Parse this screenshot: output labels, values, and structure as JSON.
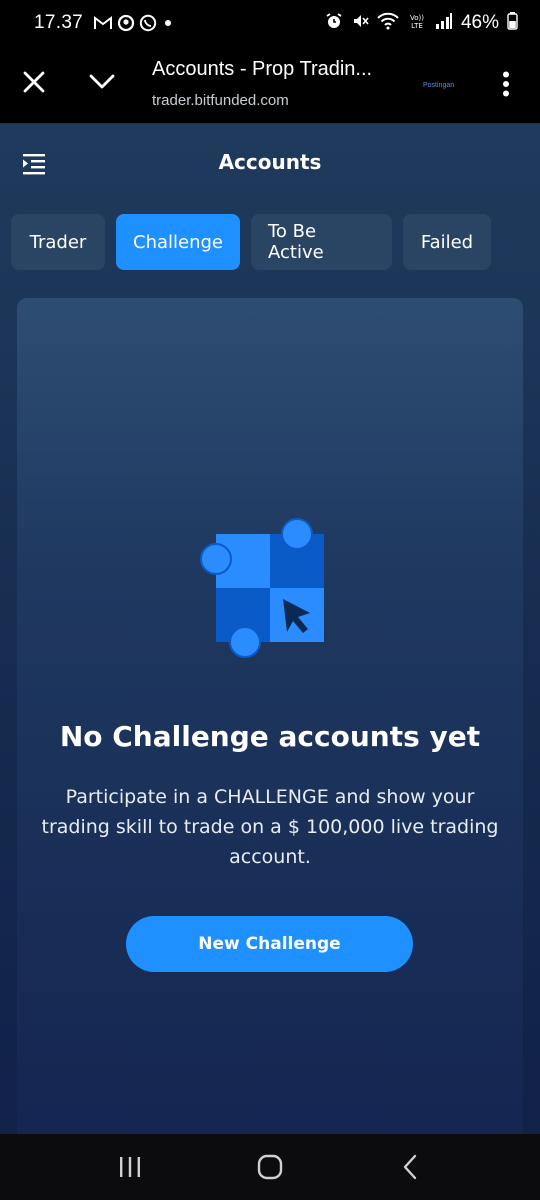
{
  "status_bar": {
    "time": "17.37",
    "notification_icons": [
      "gmail-icon",
      "location-icon",
      "whatsapp-icon",
      "dot-icon"
    ],
    "system_icons": [
      "alarm-icon",
      "mute-icon",
      "wifi-icon",
      "volte-icon",
      "signal-icon"
    ],
    "battery": "46%"
  },
  "browser": {
    "title": "Accounts - Prop Tradin...",
    "url": "trader.bitfunded.com",
    "postingan": "Postingan"
  },
  "page": {
    "title": "Accounts",
    "tabs": [
      {
        "label": "Trader",
        "active": false
      },
      {
        "label": "Challenge",
        "active": true
      },
      {
        "label": "To Be Active",
        "active": false
      },
      {
        "label": "Failed",
        "active": false
      }
    ],
    "empty_state": {
      "title": "No Challenge accounts yet",
      "description": "Participate in a CHALLENGE and show your trading skill to trade on a $ 100,000 live trading account.",
      "button_label": "New Challenge"
    }
  },
  "colors": {
    "accent": "#1e90ff",
    "tab_inactive": "#2a4564",
    "background_top": "#1f3a5c",
    "background_bottom": "#112148"
  },
  "nav_bar": {
    "icons": [
      "recent-apps-icon",
      "home-icon",
      "back-icon"
    ]
  }
}
